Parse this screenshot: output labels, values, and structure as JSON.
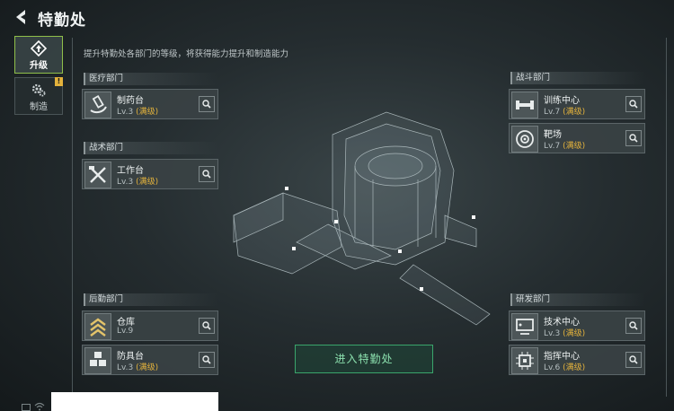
{
  "header": {
    "title": "特勤处"
  },
  "description": "提升特勤处各部门的等级，将获得能力提升和制造能力",
  "side_tabs": [
    {
      "label": "升级",
      "icon": "upgrade-icon",
      "active": true
    },
    {
      "label": "制造",
      "icon": "gears-icon",
      "badge": "!"
    }
  ],
  "departments": {
    "medical": {
      "title": "医疗部门",
      "items": [
        {
          "name": "制药台",
          "level": "Lv.3",
          "status": "(满级)",
          "icon": "pharmacy-icon"
        }
      ]
    },
    "tactical": {
      "title": "战术部门",
      "items": [
        {
          "name": "工作台",
          "level": "Lv.3",
          "status": "(满级)",
          "icon": "workbench-icon"
        }
      ]
    },
    "logistics": {
      "title": "后勤部门",
      "items": [
        {
          "name": "仓库",
          "level": "Lv.9",
          "status": "",
          "icon": "warehouse-icon"
        },
        {
          "name": "防具台",
          "level": "Lv.3",
          "status": "(满级)",
          "icon": "armor-icon"
        }
      ]
    },
    "combat": {
      "title": "战斗部门",
      "items": [
        {
          "name": "训练中心",
          "level": "Lv.7",
          "status": "(满级)",
          "icon": "training-icon"
        },
        {
          "name": "靶场",
          "level": "Lv.7",
          "status": "(满级)",
          "icon": "target-icon"
        }
      ]
    },
    "research": {
      "title": "研发部门",
      "items": [
        {
          "name": "技术中心",
          "level": "Lv.3",
          "status": "(满级)",
          "icon": "tech-icon"
        },
        {
          "name": "指挥中心",
          "level": "Lv.6",
          "status": "(满级)",
          "icon": "command-icon"
        }
      ]
    }
  },
  "enter_button": "进入特勤处",
  "colors": {
    "accent": "#8fbf4a",
    "maxed": "#e3b23c",
    "enter": "#3aa56b"
  }
}
